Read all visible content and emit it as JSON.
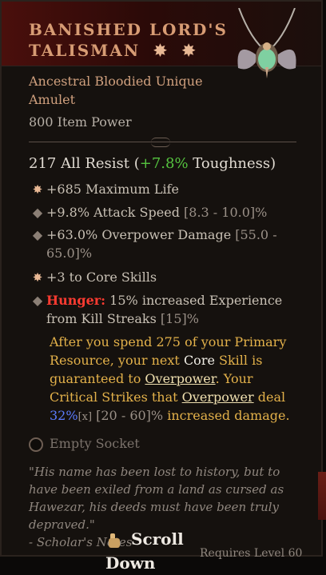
{
  "item": {
    "name_line1": "BANISHED LORD'S",
    "name_line2": "TALISMAN",
    "name_stars": "✸ ✸",
    "subtitle_line1": "Ancestral Bloodied Unique",
    "subtitle_line2": "Amulet",
    "item_power": "800 Item Power",
    "resist": {
      "main": "217 All Resist",
      "paren_open": " (",
      "toughness_value": "+7.8%",
      "toughness_label": " Toughness)"
    },
    "affixes": [
      {
        "bullet": "✸",
        "text": "+685 Maximum Life"
      },
      {
        "bullet": "◆",
        "text": "+9.8% Attack Speed",
        "range": " [8.3 - 10.0]%"
      },
      {
        "bullet": "◆",
        "text": "+63.0% Overpower Damage",
        "range": " [55.0 - 65.0]%"
      },
      {
        "bullet": "✸",
        "text": "+3 to Core Skills"
      }
    ],
    "hunger": {
      "bullet": "◆",
      "label": "Hunger:",
      "text": " 15% increased Experience from Kill Streaks",
      "range": " [15]%"
    },
    "aspect": {
      "part1": "After you spend 275 of your Primary Resource, your next ",
      "core": "Core",
      "part2": " Skill is guaranteed to ",
      "overpower1": "Overpower",
      "part3": ". Your Critical Strikes that ",
      "overpower2": "Overpower",
      "part4": " deal ",
      "value": "32%",
      "x": "[x]",
      "range": " [20 - 60]%",
      "part5": " increased damage."
    },
    "socket": "Empty Socket",
    "flavor": "\"His name has been lost to history, but to have been exiled from a land as cursed as Hawezar, his deeds must have been truly depraved.\"",
    "flavor_attrib": "- Scholar's Notes",
    "scroll_label": "Scroll Down",
    "requires": "Requires Level 60"
  },
  "colors": {
    "title": "#d79c74",
    "unique": "#e3b14a",
    "green": "#55c33f",
    "hunger": "#ff3b31",
    "value_blue": "#5c7cff"
  },
  "icons": {
    "stars": "star-burst-icon",
    "socket": "empty-socket-icon",
    "scroll": "hand-pointer-icon"
  }
}
